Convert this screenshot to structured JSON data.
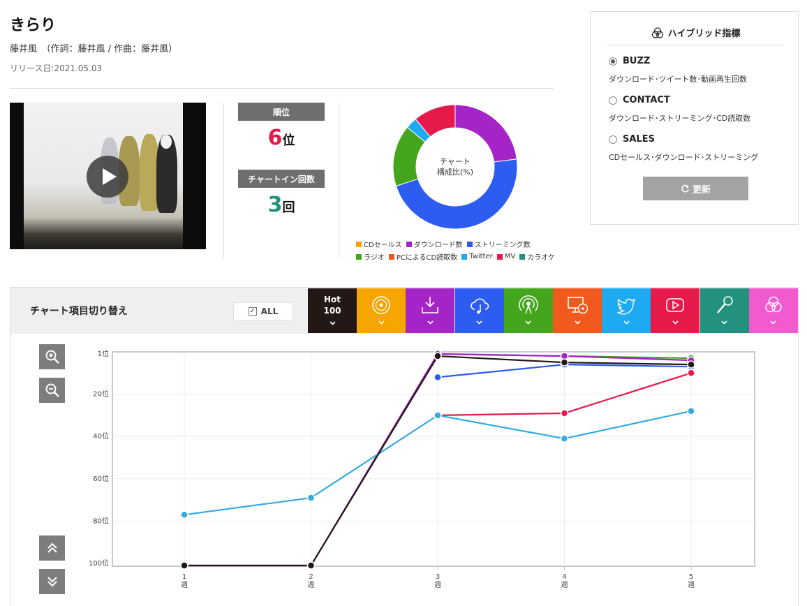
{
  "song": {
    "title": "きらり",
    "credits": "藤井風　（作詞：藤井風 / 作曲：藤井風）",
    "release": "リリース日:2021.05.03"
  },
  "stats": {
    "rank_label": "順位",
    "rank_value": "6",
    "rank_unit": "位",
    "chart_in_label": "チャートイン回数",
    "chart_in_value": "3",
    "chart_in_unit": "回"
  },
  "donut": {
    "center_line1": "チャート",
    "center_line2": "構成比(%)",
    "legend_row1": [
      {
        "label": "CDセールス",
        "color": "#f7a500"
      },
      {
        "label": "ダウンロード数",
        "color": "#a524c8"
      },
      {
        "label": "ストリーミング数",
        "color": "#2c5cf0"
      }
    ],
    "legend_row2": [
      {
        "label": "ラジオ",
        "color": "#43a61c"
      },
      {
        "label": "PCによるCD読取数",
        "color": "#f25a1d"
      },
      {
        "label": "Twitter",
        "color": "#1eaaf1"
      },
      {
        "label": "MV",
        "color": "#e6194b"
      },
      {
        "label": "カラオケ",
        "color": "#23917d"
      }
    ]
  },
  "hybrid": {
    "title": "ハイブリッド指標",
    "options": [
      {
        "label": "BUZZ",
        "desc": "ダウンロード･ツイート数･動画再生回数",
        "selected": true
      },
      {
        "label": "CONTACT",
        "desc": "ダウンロード･ストリーミング･CD読取数",
        "selected": false
      },
      {
        "label": "SALES",
        "desc": "CDセールス･ダウンロード･ストリーミング",
        "selected": false
      }
    ],
    "refresh_label": "更新"
  },
  "toolbar": {
    "title": "チャート項目切り替え",
    "all_label": "ALL",
    "hot_label_1": "Hot",
    "hot_label_2": "100",
    "categories": [
      {
        "name": "hot100",
        "color": "#231815",
        "icon": "hot100"
      },
      {
        "name": "cd-sales",
        "color": "#f7a500",
        "icon": "disc-icon"
      },
      {
        "name": "download",
        "color": "#a524c8",
        "icon": "download-icon"
      },
      {
        "name": "streaming",
        "color": "#2c5cf0",
        "icon": "cloud-music-icon"
      },
      {
        "name": "radio",
        "color": "#43a61c",
        "icon": "radio-icon"
      },
      {
        "name": "pc-cd-read",
        "color": "#f25a1d",
        "icon": "pc-disc-icon"
      },
      {
        "name": "twitter",
        "color": "#1eaaf1",
        "icon": "twitter-icon"
      },
      {
        "name": "mv",
        "color": "#e6194b",
        "icon": "youtube-icon"
      },
      {
        "name": "karaoke",
        "color": "#23917d",
        "icon": "microphone-icon"
      },
      {
        "name": "hybrid",
        "color": "#f25ad0",
        "icon": "venn-icon"
      }
    ]
  },
  "chart_data": [
    {
      "type": "pie",
      "categories": [
        "ダウンロード数",
        "ストリーミング数",
        "ラジオ",
        "Twitter",
        "MV"
      ],
      "values": [
        23,
        47,
        16,
        3,
        11
      ],
      "colors": [
        "#a524c8",
        "#2c5cf0",
        "#43a61c",
        "#1eaaf1",
        "#e6194b"
      ],
      "title": ""
    },
    {
      "type": "line",
      "x": [
        1,
        2,
        3,
        4,
        5
      ],
      "x_tick_labels": [
        "1\n週",
        "2\n週",
        "3\n週",
        "4\n週",
        "5\n週"
      ],
      "y_ticks": [
        "1位",
        "20位",
        "40位",
        "60位",
        "80位",
        "100位"
      ],
      "y_tick_values": [
        1,
        20,
        40,
        60,
        80,
        100
      ],
      "ylim": [
        1,
        100
      ],
      "y_inverted": true,
      "grid": true,
      "series": [
        {
          "color": "#43a61c",
          "x": [
            3,
            4,
            5
          ],
          "values": [
            1,
            2,
            3
          ]
        },
        {
          "color": "#a524c8",
          "x": [
            1,
            2,
            3,
            4,
            5
          ],
          "values": [
            101,
            101,
            1,
            2,
            4
          ]
        },
        {
          "color": "#2c5cf0",
          "x": [
            3,
            4,
            5
          ],
          "values": [
            12,
            6,
            7
          ]
        },
        {
          "color": "#e6194b",
          "x": [
            3,
            4,
            5
          ],
          "values": [
            30,
            29,
            10
          ]
        },
        {
          "color": "#34aae0",
          "x": [
            1,
            2,
            3,
            4,
            5
          ],
          "values": [
            77,
            69,
            30,
            41,
            28
          ]
        },
        {
          "color": "#231815",
          "x": [
            1,
            2,
            3,
            4,
            5
          ],
          "values": [
            101,
            101,
            2,
            5,
            6
          ]
        }
      ]
    }
  ]
}
